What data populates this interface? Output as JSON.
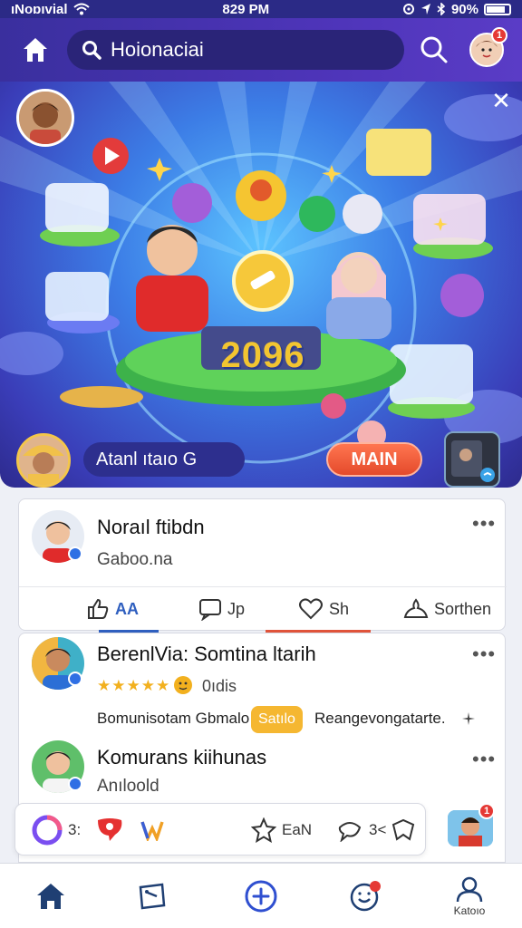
{
  "status_bar": {
    "carrier": "ıNoɒıvial",
    "time": "829 PM",
    "battery": "90%"
  },
  "app_bar": {
    "search_value": "Hoionaciai",
    "profile_badge": "1"
  },
  "hero": {
    "banner_number": "2096",
    "label_pill": "Atanl ıtaıo G",
    "main_button": "MAIN",
    "close_label": "✕"
  },
  "post": {
    "author": "Noraıl ftibdn",
    "subtitle": "Gaboo.na",
    "menu": "•••",
    "actions": [
      {
        "label": "AA",
        "icon": "like-icon",
        "color": "#2f5fbf"
      },
      {
        "label": "Jp",
        "icon": "comment-icon",
        "color": "#333333"
      },
      {
        "label": "Sh",
        "icon": "heart-icon",
        "color": "#e0533a"
      },
      {
        "label": "Sorthen",
        "icon": "share-icon",
        "color": "#333333"
      }
    ]
  },
  "comments": [
    {
      "author": "BerenlVia: Somtina ltarih",
      "rating_text": "0ıdis",
      "body_before": "Bomunisotam Gbmalo",
      "tag": "Satılo",
      "body_after": "Reangevongatarte.",
      "menu": "•••"
    },
    {
      "author": "Komurans kiihunas",
      "subtitle": "Anıloold",
      "menu": "•••"
    }
  ],
  "composer": {
    "count_1": "3:",
    "action_label": "EaN",
    "count_2": "3<",
    "avatar_badge": "1"
  },
  "bottom_nav": {
    "items": [
      {
        "label": "",
        "icon": "home-icon"
      },
      {
        "label": "",
        "icon": "map-icon"
      },
      {
        "label": "",
        "icon": "add-icon"
      },
      {
        "label": "",
        "icon": "notifications-icon",
        "badge": "•"
      },
      {
        "label": "Katoıo",
        "icon": "profile-icon"
      }
    ]
  },
  "colors": {
    "primary": "#4d34b8",
    "accent": "#e44a2b",
    "link": "#2f5fbf"
  }
}
